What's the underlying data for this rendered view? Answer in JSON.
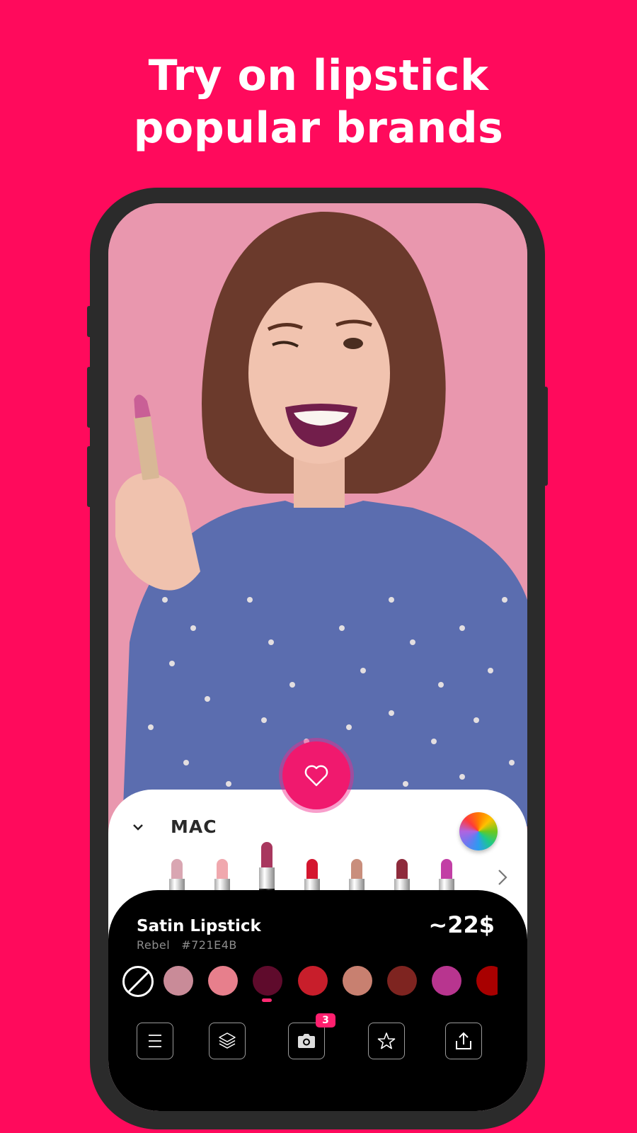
{
  "headline": {
    "line1": "Try on lipstick",
    "line2": "popular brands"
  },
  "brand": {
    "name": "MAC",
    "collapse_icon": "chevron-down-icon",
    "color_picker_icon": "color-wheel-icon",
    "next_icon": "chevron-right-icon"
  },
  "lipsticks": [
    {
      "color": "#D9A6B2",
      "selected": false
    },
    {
      "color": "#F0A8AE",
      "selected": false
    },
    {
      "color": "#A8375E",
      "selected": true
    },
    {
      "color": "#D4162F",
      "selected": false
    },
    {
      "color": "#C98E7C",
      "selected": false
    },
    {
      "color": "#8E2B3C",
      "selected": false
    },
    {
      "color": "#C23FA5",
      "selected": false
    }
  ],
  "product": {
    "name": "Satin Lipstick",
    "shade": "Rebel",
    "hex": "#721E4B",
    "price": "~22$"
  },
  "swatches": [
    {
      "type": "none",
      "icon": "no-color-icon"
    },
    {
      "color": "#C98B98"
    },
    {
      "color": "#E77F8C"
    },
    {
      "color": "#5F0B2C",
      "selected": true
    },
    {
      "color": "#C81E2B"
    },
    {
      "color": "#C88070"
    },
    {
      "color": "#7E2420"
    },
    {
      "color": "#B8358F"
    },
    {
      "color": "#A80000"
    }
  ],
  "toolbar": [
    {
      "name": "menu",
      "icon": "menu-icon"
    },
    {
      "name": "layers",
      "icon": "layers-icon"
    },
    {
      "name": "camera",
      "icon": "camera-icon",
      "badge": "3"
    },
    {
      "name": "favorites",
      "icon": "star-icon"
    },
    {
      "name": "share",
      "icon": "share-icon"
    }
  ],
  "favorite_icon": "heart-icon",
  "colors": {
    "background": "#FF0A5C",
    "accent": "#F0196E",
    "badge": "#FF1F6E",
    "phone_frame": "#2B2B2B"
  }
}
